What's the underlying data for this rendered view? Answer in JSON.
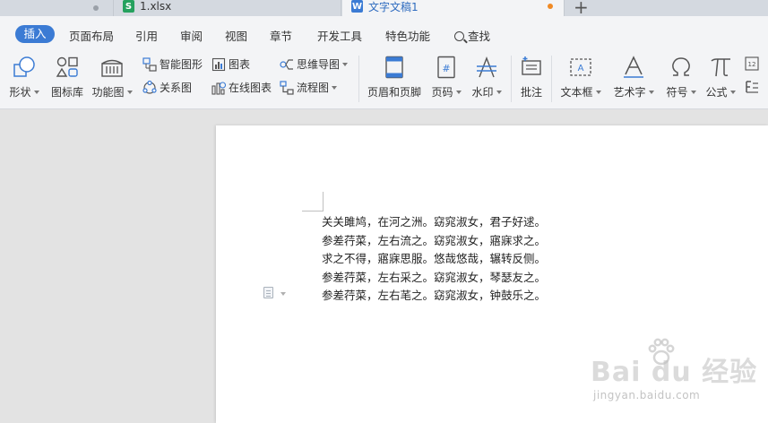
{
  "tabs": [
    {
      "label": "",
      "type": "blank"
    },
    {
      "label": "1.xlsx",
      "icon": "spreadsheet-icon",
      "icon_letter": "S"
    },
    {
      "label": "文字文稿1",
      "icon": "writer-doc-icon",
      "icon_letter": "W",
      "active": true
    }
  ],
  "new_tab": "+",
  "menu": {
    "items": [
      "插入",
      "页面布局",
      "引用",
      "审阅",
      "视图",
      "章节",
      "开发工具",
      "特色功能",
      "查找"
    ],
    "active": "插入"
  },
  "ribbon": {
    "shape": "形状",
    "icon_lib": "图标库",
    "func_chart": "功能图",
    "smart_shape": "智能图形",
    "chart": "图表",
    "mindmap": "思维导图",
    "relation": "关系图",
    "online_chart": "在线图表",
    "flowchart": "流程图",
    "header_footer": "页眉和页脚",
    "page_number": "页码",
    "watermark": "水印",
    "comment": "批注",
    "textbox": "文本框",
    "wordart": "艺术字",
    "symbol": "符号",
    "formula": "公式"
  },
  "document": {
    "lines": [
      "关关雎鸠，在河之洲。窈窕淑女，君子好逑。",
      "参差荇菜，左右流之。窈窕淑女，寤寐求之。",
      "求之不得，寤寐思服。悠哉悠哉，辗转反侧。",
      "参差荇菜，左右采之。窈窕淑女，琴瑟友之。",
      "参差荇菜，左右芼之。窈窕淑女，钟鼓乐之。"
    ]
  },
  "watermark": {
    "logo": "Bai  du 经验",
    "url": "jingyan.baidu.com"
  },
  "colors": {
    "accent": "#3b7bd4",
    "tab_modified_dot": "#f08a24",
    "xlsx_icon": "#25a15e"
  }
}
